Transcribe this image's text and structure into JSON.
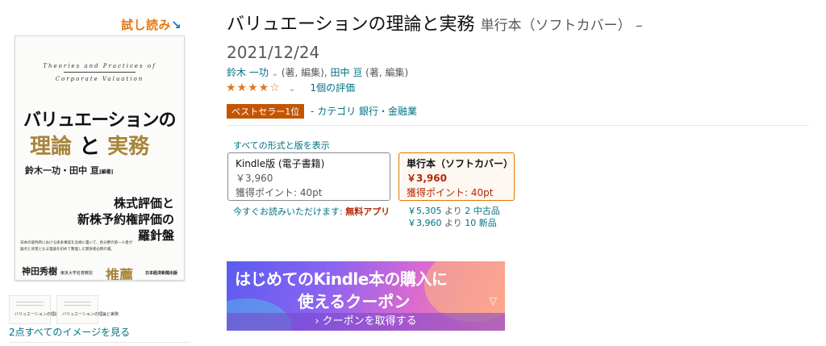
{
  "left": {
    "sample_label": "試し読み",
    "sample_arrow": "↘",
    "cover": {
      "en_line1": "Theories and Practices of",
      "en_line2": "Corporate Valuation",
      "title_line1": "バリュエーションの",
      "title_word1": "理論",
      "title_and": "と",
      "title_word2": "実務",
      "authors": "鈴木一功・田中 亘",
      "authors_role": "[編著]",
      "sub_line1": "株式評価と",
      "sub_line2": "新株予約権評価の",
      "sub_line3": "羅針盤",
      "blurb": "日本の裁判所における係争事案を念頭に置いて、各分野の第一人者が論点と背景となる理論を初めて整理した関係者必携の書。",
      "recommender": "神田秀樹",
      "recommender_title": "東京大学名誉教授",
      "recommend_label": "推薦",
      "publisher": "日本経済新聞出版"
    },
    "thumb_text": "バリュエーションの理論と実務",
    "all_images_link": "2点すべてのイメージを見る"
  },
  "product": {
    "title": "バリュエーションの理論と実務",
    "format": "単行本（ソフトカバー） –",
    "date": "2021/12/24",
    "author1": "鈴木 一功",
    "author1_role": "(著, 編集),",
    "author2": "田中 亘",
    "author2_role": "(著, 編集)",
    "rating_value": 4,
    "rating_max": 5,
    "stars_text": "★★★★☆",
    "ratings_count": "1個の評価",
    "bestseller_badge": "ベストセラー1位",
    "category_prefix": "- カテゴリ",
    "category": "銀行・金融業"
  },
  "formats": {
    "all_formats_link": "すべての形式と版を表示",
    "kindle": {
      "name": "Kindle版 (電子書籍)",
      "price": "￥3,960",
      "points": "獲得ポイント: 40pt"
    },
    "paperback": {
      "name": "単行本（ソフトカバー）",
      "price": "￥3,960",
      "points": "獲得ポイント: 40pt"
    },
    "kindle_note": "今すぐお読みいただけます:",
    "kindle_app": "無料アプリ",
    "used_price": "￥5,305",
    "used_from": "より",
    "used_count": "2 中古品",
    "new_price": "￥3,960",
    "new_from": "より",
    "new_count": "10 新品"
  },
  "banner": {
    "line1": "はじめてのKindle本の購入に",
    "line2": "使えるクーポン",
    "cta": "› クーポンを取得する",
    "dropdown": "▽"
  },
  "colors": {
    "link": "#007185",
    "price": "#b12704",
    "badge": "#c45500",
    "stars": "#de7921",
    "selected_border": "#e77600"
  }
}
